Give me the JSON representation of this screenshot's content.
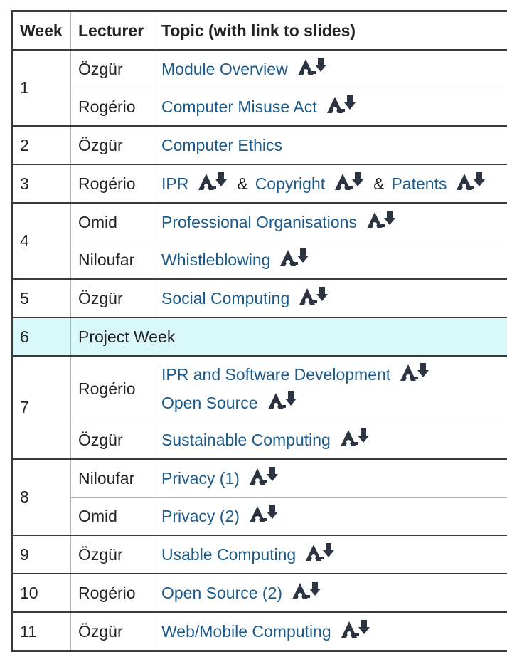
{
  "headers": {
    "week": "Week",
    "lecturer": "Lecturer",
    "topic": "Topic (with link to slides)"
  },
  "rows": {
    "r1": {
      "week": "1",
      "lecturer": "Özgür",
      "topic": "Module Overview"
    },
    "r2": {
      "lecturer": "Rogério",
      "topic": "Computer Misuse Act"
    },
    "r3": {
      "week": "2",
      "lecturer": "Özgür",
      "topic": "Computer Ethics"
    },
    "r4": {
      "week": "3",
      "lecturer": "Rogério",
      "topic_a": "IPR",
      "amp1": "&",
      "topic_b": "Copyright",
      "amp2": "&",
      "topic_c": "Patents"
    },
    "r5": {
      "week": "4",
      "lecturer": "Omid",
      "topic": "Professional Organisations"
    },
    "r6": {
      "lecturer": "Niloufar",
      "topic": "Whistleblowing"
    },
    "r7": {
      "week": "5",
      "lecturer": "Özgür",
      "topic": "Social Computing"
    },
    "r8": {
      "week": "6",
      "label": "Project Week"
    },
    "r9": {
      "week": "7",
      "lecturer": "Rogério",
      "topic_a": "IPR and Software Development",
      "topic_b": "Open Source"
    },
    "r10": {
      "lecturer": "Özgür",
      "topic": "Sustainable Computing"
    },
    "r11": {
      "week": "8",
      "lecturer": "Niloufar",
      "topic": "Privacy (1)"
    },
    "r12": {
      "lecturer": "Omid",
      "topic": "Privacy (2)"
    },
    "r13": {
      "week": "9",
      "lecturer": "Özgür",
      "topic": "Usable Computing"
    },
    "r14": {
      "week": "10",
      "lecturer": "Rogério",
      "topic": "Open Source (2)"
    },
    "r15": {
      "week": "11",
      "lecturer": "Özgür",
      "topic": "Web/Mobile Computing"
    }
  },
  "icons": {
    "download": "pdf-download-icon",
    "color": "#2b3440"
  },
  "colors": {
    "link": "#1b5a8a",
    "highlight": "#d9f8fa",
    "border": "#b0b0b0"
  }
}
